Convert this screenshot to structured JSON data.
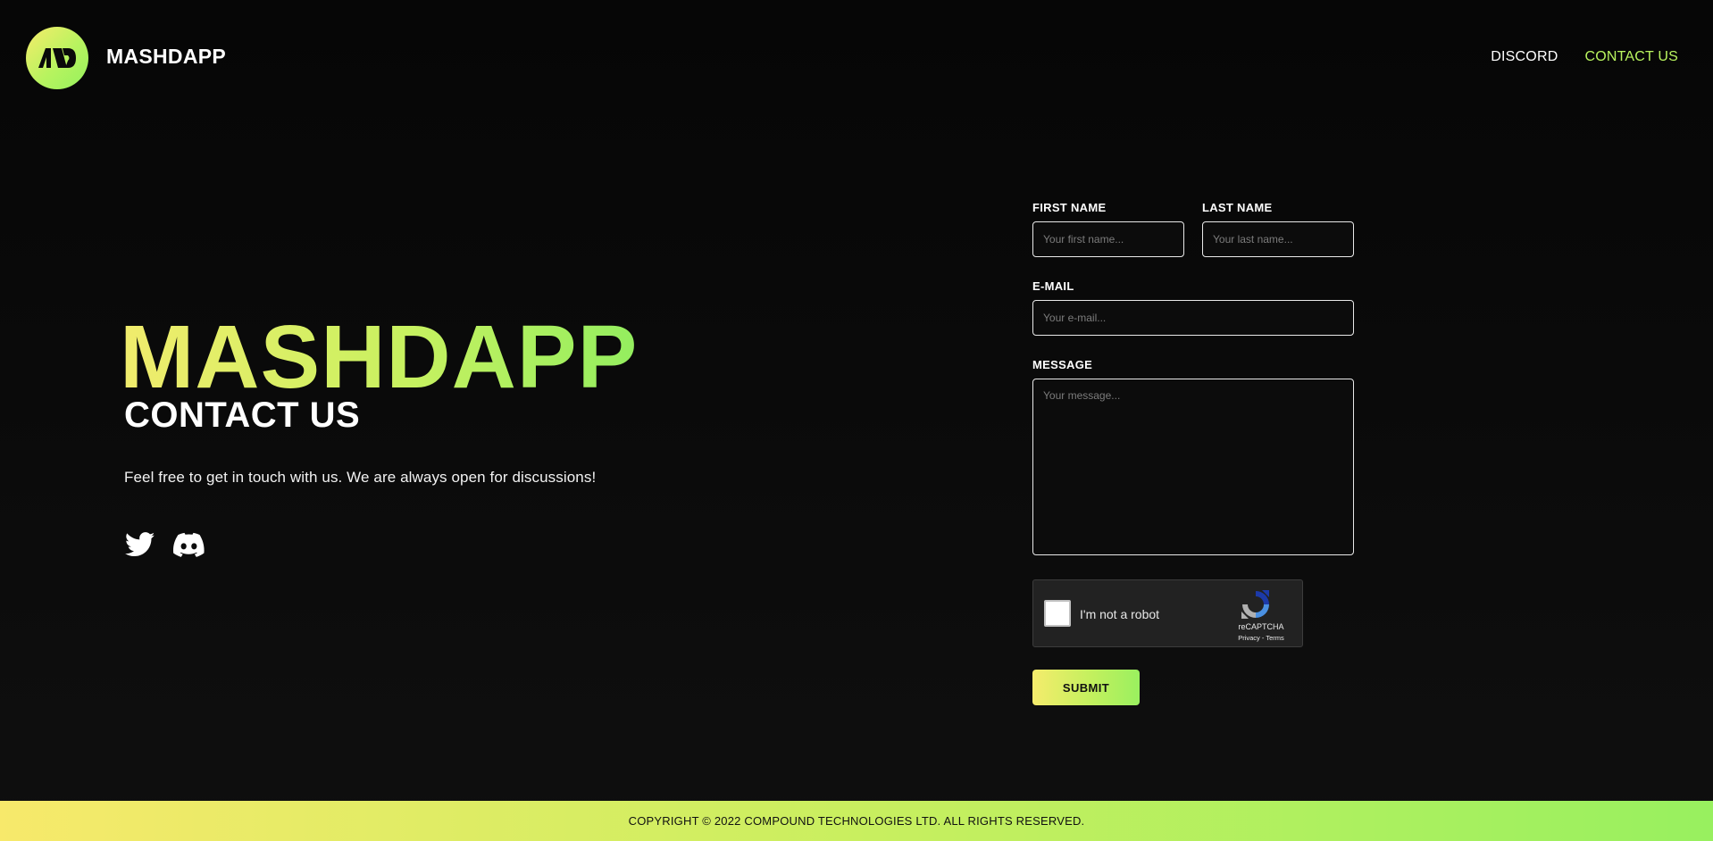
{
  "brand": {
    "name": "MASHDAPP",
    "logo_mark": "MD"
  },
  "nav": {
    "items": [
      {
        "label": "DISCORD"
      },
      {
        "label": "CONTACT US"
      }
    ],
    "active_color": "#b9f45f"
  },
  "hero": {
    "title": "MASHDAPP",
    "subtitle": "CONTACT US",
    "description": "Feel free to get in touch with us. We are always open for discussions!",
    "socials": [
      {
        "icon": "twitter-icon"
      },
      {
        "icon": "discord-icon"
      }
    ]
  },
  "form": {
    "first_name": {
      "label": "FIRST NAME",
      "placeholder": "Your first name...",
      "value": ""
    },
    "last_name": {
      "label": "LAST NAME",
      "placeholder": "Your last name...",
      "value": ""
    },
    "email": {
      "label": "E-MAIL",
      "placeholder": "Your e-mail...",
      "value": ""
    },
    "message": {
      "label": "MESSAGE",
      "placeholder": "Your message...",
      "value": ""
    },
    "captcha": {
      "label": "I'm not a robot",
      "brand": "reCAPTCHA",
      "links": "Privacy - Terms"
    },
    "submit_label": "SUBMIT"
  },
  "footer": {
    "copyright": "COPYRIGHT © 2022 COMPOUND TECHNOLOGIES LTD. ALL RIGHTS RESERVED."
  },
  "colors": {
    "background": "#0a0a0a",
    "accent_yellow": "#f5ec6c",
    "accent_green": "#98f05f"
  }
}
